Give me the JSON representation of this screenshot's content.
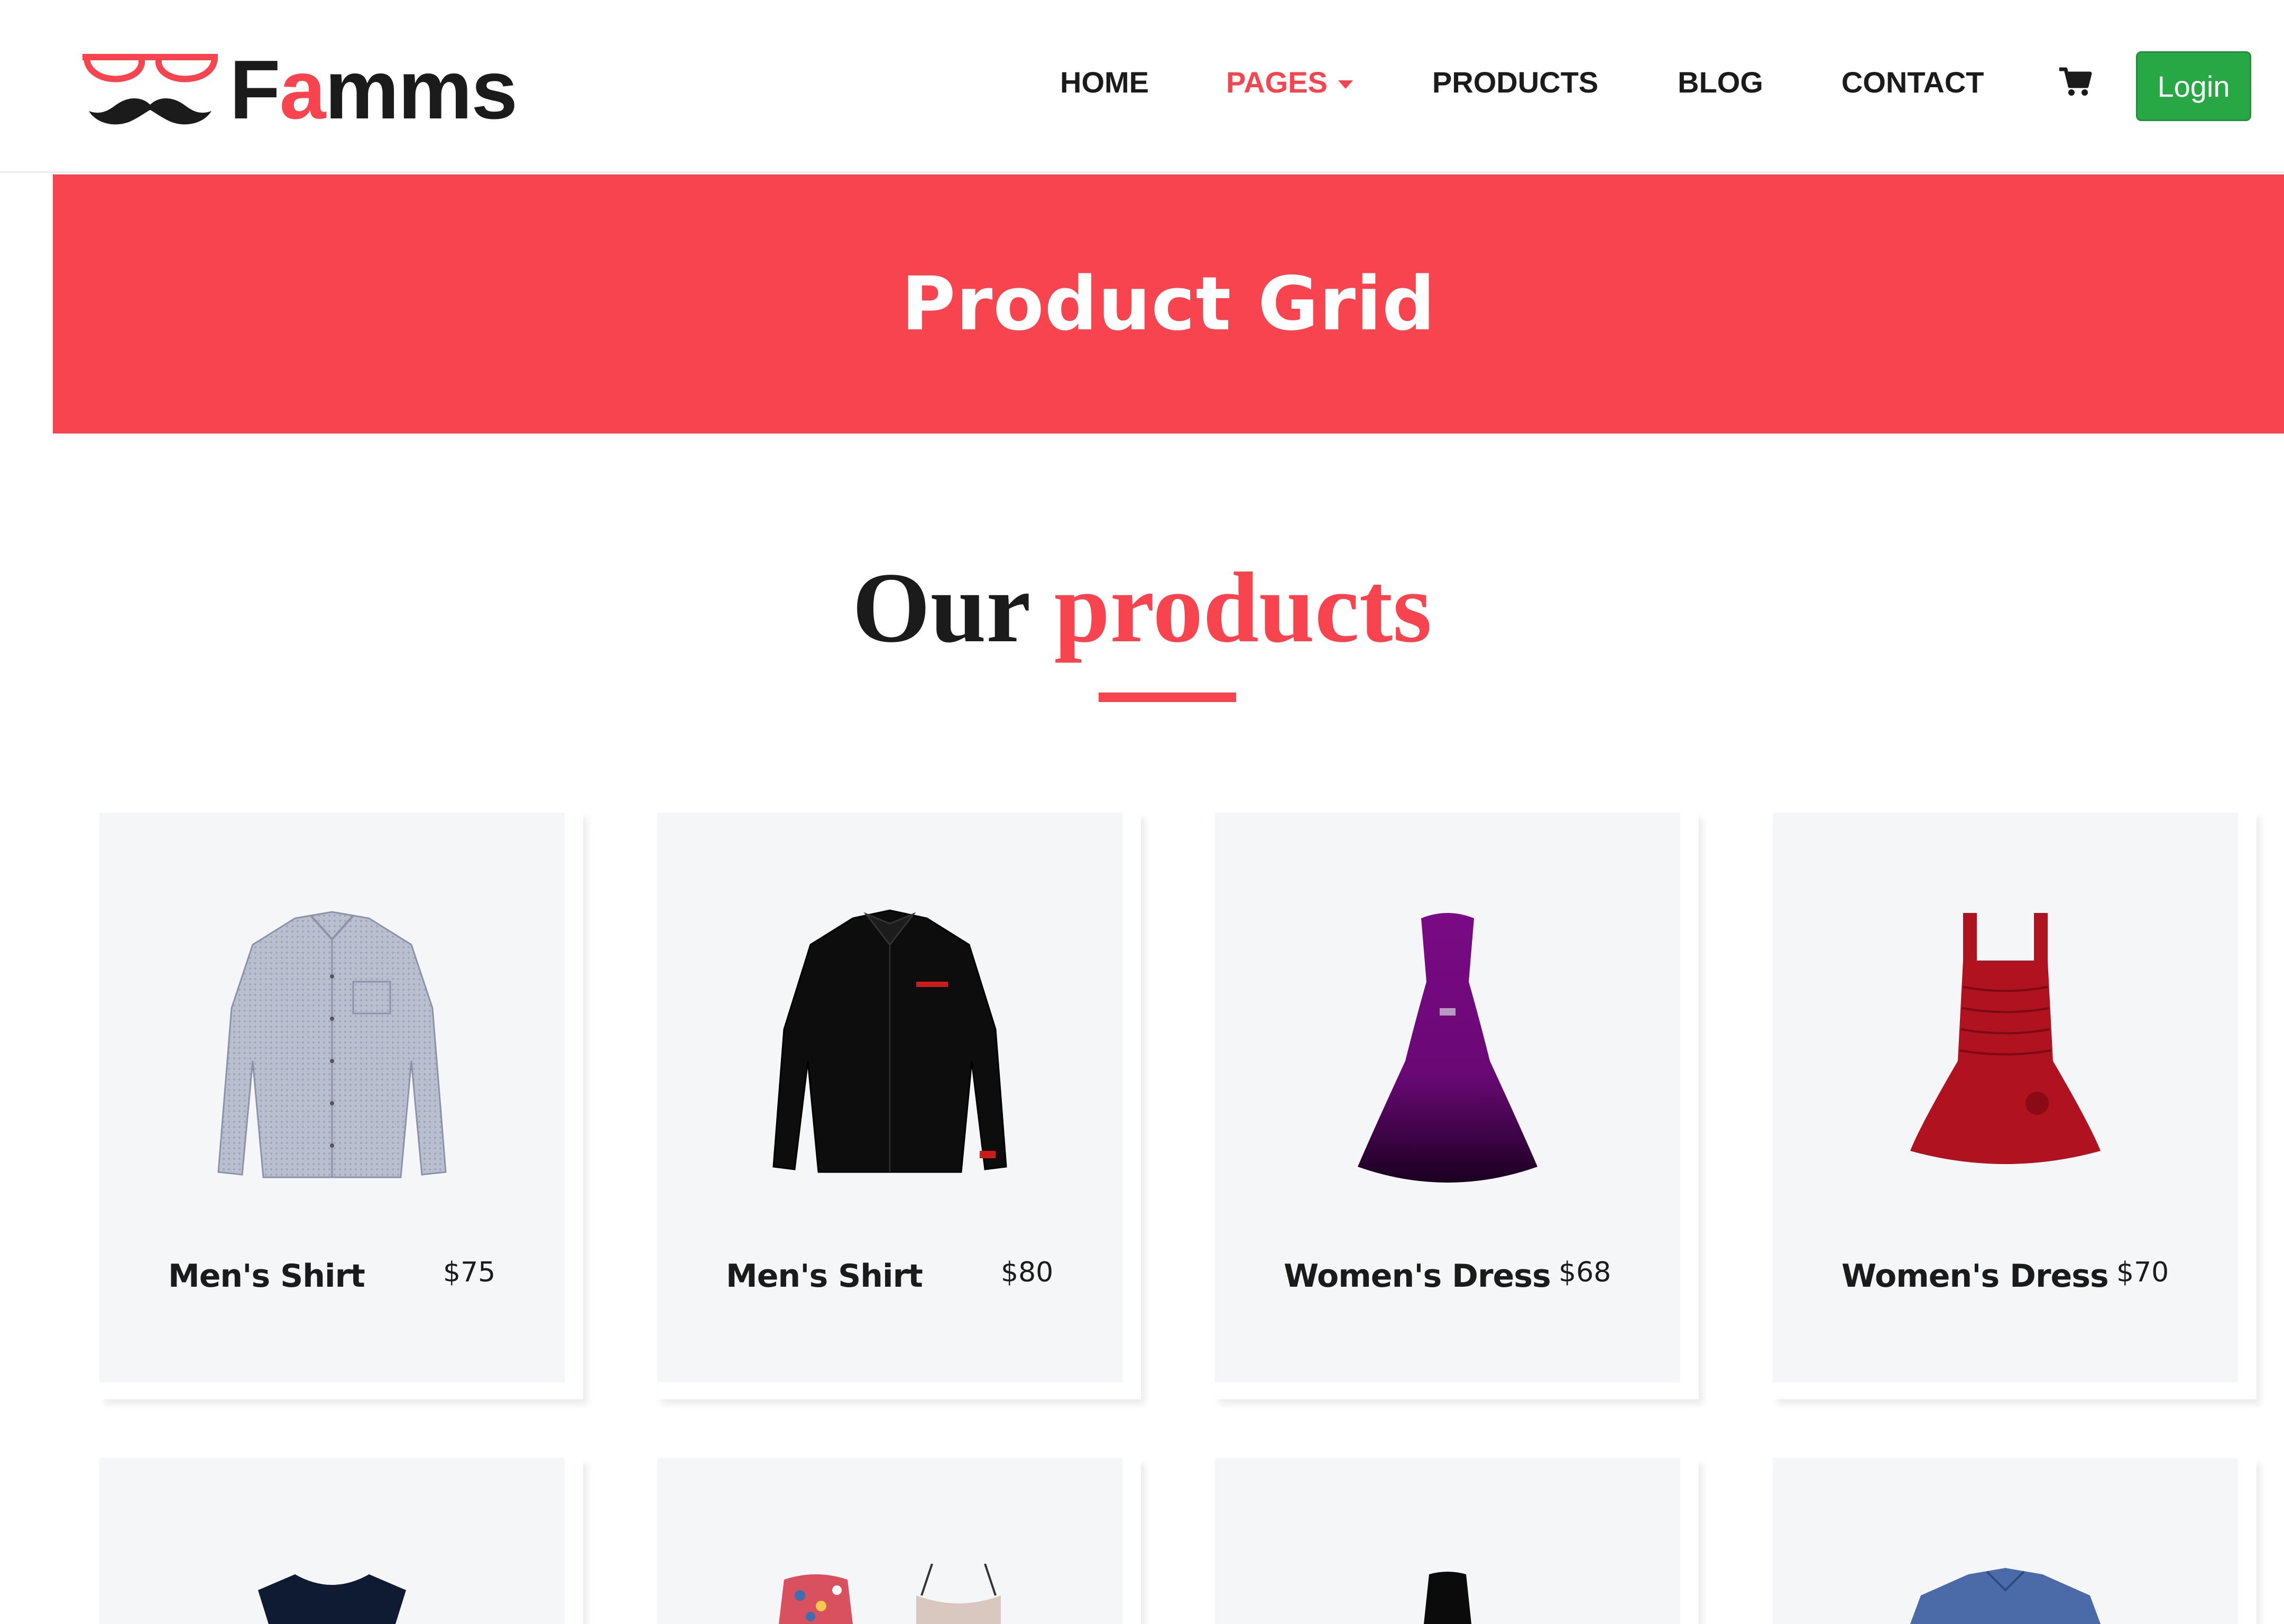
{
  "header": {
    "logo_text_start": "F",
    "logo_text_accent": "a",
    "logo_text_end": "mms",
    "nav": [
      {
        "label": "HOME"
      },
      {
        "label": "PAGES"
      },
      {
        "label": "PRODUCTS"
      },
      {
        "label": "BLOG"
      },
      {
        "label": "CONTACT"
      }
    ],
    "cart_icon": "cart-icon",
    "login_label": "Login"
  },
  "banner": {
    "title": "Product Grid"
  },
  "section": {
    "heading_part1": "Our",
    "heading_part2": "products"
  },
  "products": [
    {
      "name": "Men's Shirt",
      "price": "$75",
      "icon": "light-shirt-image"
    },
    {
      "name": "Men's Shirt",
      "price": "$80",
      "icon": "black-shirt-image"
    },
    {
      "name": "Women's Dress",
      "price": "$68",
      "icon": "purple-gown-image"
    },
    {
      "name": "Women's Dress",
      "price": "$70",
      "icon": "red-dress-image"
    },
    {
      "name": "",
      "price": "",
      "icon": "navy-top-image"
    },
    {
      "name": "",
      "price": "",
      "icon": "floral-top-image"
    },
    {
      "name": "",
      "price": "",
      "icon": "black-dress-image"
    },
    {
      "name": "",
      "price": "",
      "icon": "blue-shirt-image"
    }
  ],
  "colors": {
    "accent": "#f7444e",
    "login": "#28a745",
    "card_bg": "#f5f6f8"
  }
}
